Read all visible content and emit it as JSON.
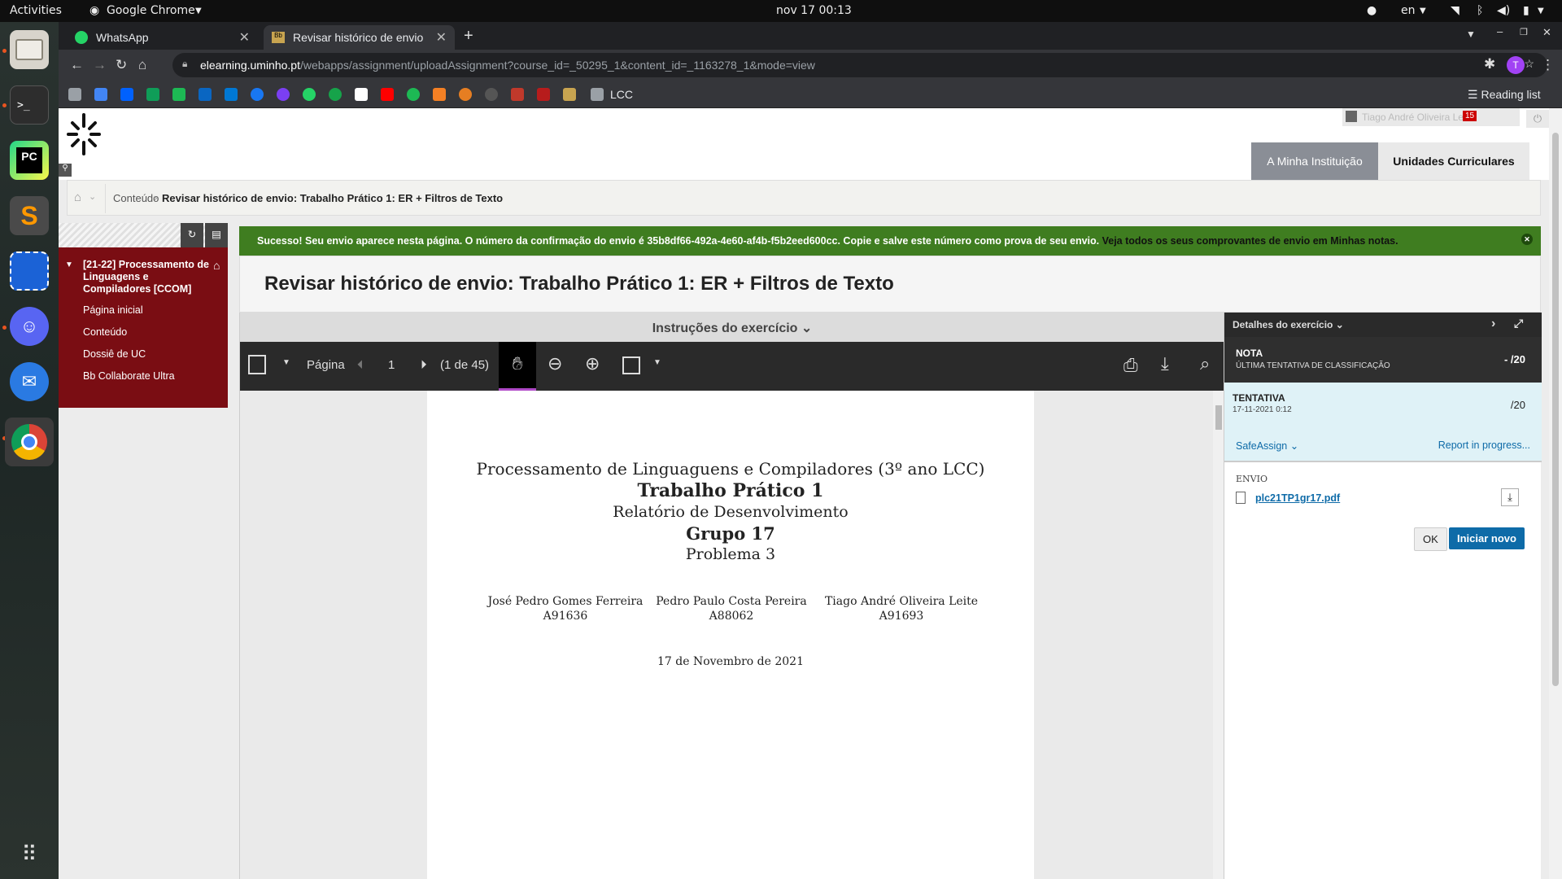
{
  "topbar": {
    "activities": "Activities",
    "app": "Google Chrome",
    "clock": "nov 17  00:13",
    "lang": "en"
  },
  "dock": {
    "items": [
      "files-icon",
      "terminal-icon",
      "pycharm-icon",
      "sublime-icon",
      "screenshot-icon",
      "discord-icon",
      "thunderbird-icon",
      "chrome-icon"
    ]
  },
  "tabs": [
    {
      "title": "WhatsApp"
    },
    {
      "title": "Revisar histórico de envio"
    }
  ],
  "address": {
    "host": "elearning.uminho.pt",
    "path": "/webapps/assignment/uploadAssignment?course_id=_50295_1&content_id=_1163278_1&mode=view",
    "avatar": "T"
  },
  "bookmarks": {
    "folder": "LCC",
    "reading_list": "Reading list"
  },
  "site": {
    "user": "Tiago André Oliveira Leite",
    "notifications": "15",
    "nav_tabs": [
      "A Minha Instituição",
      "Unidades Curriculares"
    ]
  },
  "breadcrumb": {
    "item1": "Conteúdo",
    "current": "Revisar histórico de envio: Trabalho Prático 1: ER + Filtros de Texto"
  },
  "sidebar": {
    "course": "[21-22] Processamento de Linguagens e Compiladores [CCOM]",
    "items": [
      "Página inicial",
      "Conteúdo",
      "Dossiê de UC",
      "Bb Collaborate Ultra"
    ]
  },
  "success": {
    "text": "Sucesso! Seu envio aparece nesta página. O número da confirmação do envio é 35b8df66-492a-4e60-af4b-f5b2eed600cc. Copie e salve este número como prova de seu envio.",
    "link": "Veja todos os seus comprovantes de envio em Minhas notas."
  },
  "title": "Revisar histórico de envio: Trabalho Prático 1: ER + Filtros de Texto",
  "viewer": {
    "instructions": "Instruções do exercício",
    "page_label": "Página",
    "page_num": "1",
    "page_count": "(1 de 45)"
  },
  "pdf": {
    "line1": "Processamento de Linguaguens e Compiladores (3º ano LCC)",
    "line2": "Trabalho Prático 1",
    "line3": "Relatório de Desenvolvimento",
    "line4": "Grupo 17",
    "line5": "Problema 3",
    "authors": [
      {
        "name": "José Pedro Gomes Ferreira",
        "id": "A91636"
      },
      {
        "name": "Pedro Paulo Costa Pereira",
        "id": "A88062"
      },
      {
        "name": "Tiago André Oliveira Leite",
        "id": "A91693"
      }
    ],
    "date": "17 de Novembro de 2021"
  },
  "details": {
    "header": "Detalhes do exercício",
    "nota_label": "NOTA",
    "nota_sub": "ÚLTIMA TENTATIVA DE CLASSIFICAÇÃO",
    "nota_value": "- /20",
    "tentativa_label": "TENTATIVA",
    "tentativa_date": "17-11-2021 0:12",
    "tentativa_value": "/20",
    "safeassign": "SafeAssign",
    "report": "Report in progress...",
    "envio_label": "ENVIO",
    "file": "plc21TP1gr17.pdf",
    "ok": "OK",
    "new": "Iniciar novo"
  },
  "colors": {
    "success_green": "#3f7d20",
    "sidebar_red": "#7a0d13",
    "primary_blue": "#0e6ba8"
  }
}
